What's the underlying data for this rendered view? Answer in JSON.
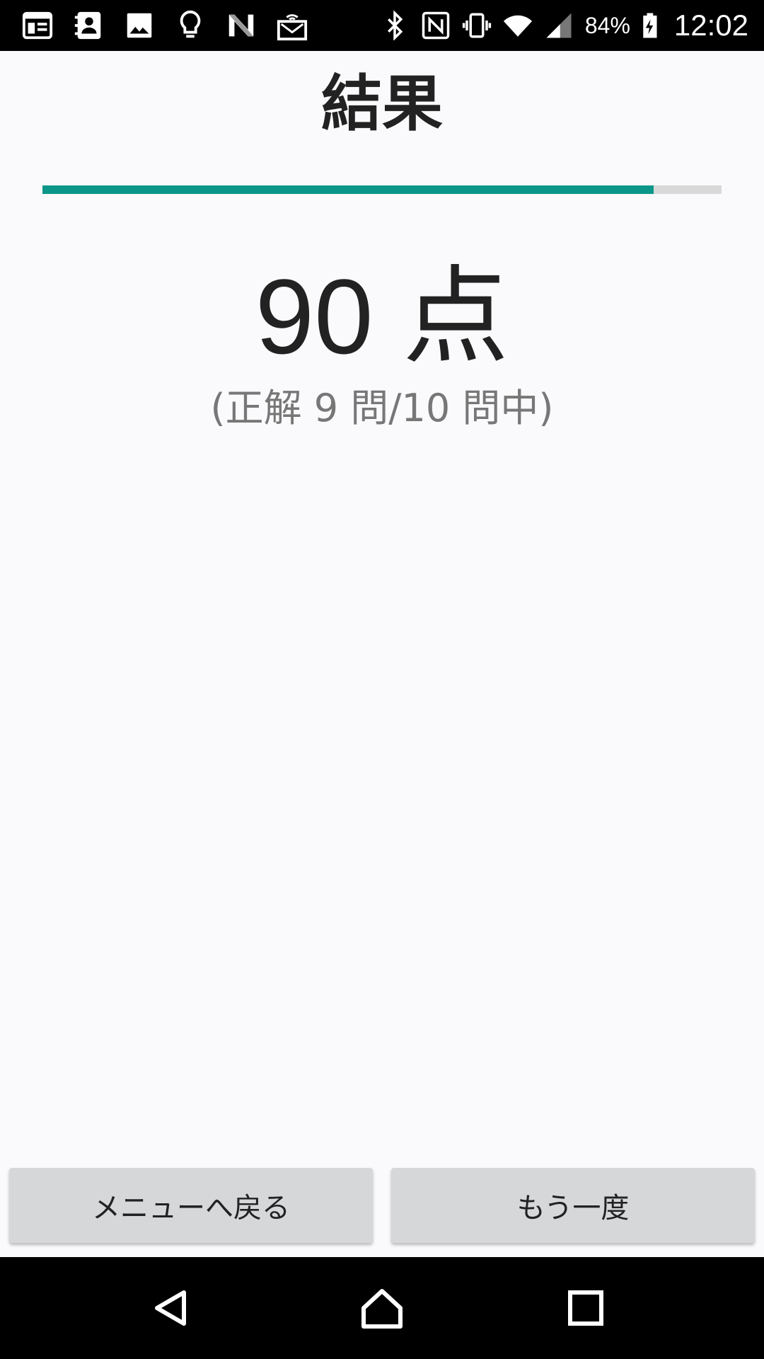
{
  "status_bar": {
    "left_icons": [
      "news-icon",
      "contacts-icon",
      "image-icon",
      "lightbulb-icon",
      "n-app-icon",
      "wireless-display-icon"
    ],
    "right_icons": [
      "bluetooth-icon",
      "nfc-icon",
      "vibrate-icon",
      "wifi-icon",
      "signal-icon"
    ],
    "battery_percent": "84%",
    "time": "12:02"
  },
  "result": {
    "title": "結果",
    "progress": 0.9,
    "score": "90 点",
    "detail": "(正解 9 問/10 問中)"
  },
  "buttons": {
    "menu": "メニューへ戻る",
    "retry": "もう一度"
  },
  "nav": [
    "back-icon",
    "home-icon",
    "recent-apps-icon"
  ],
  "colors": {
    "accent": "#0a9688",
    "background": "#faf9fb"
  }
}
